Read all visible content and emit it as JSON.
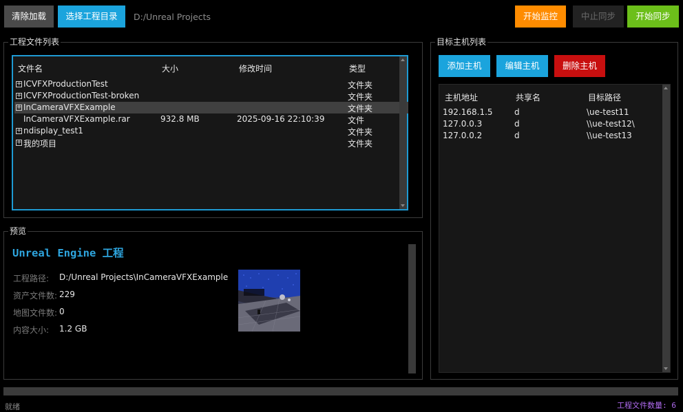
{
  "toolbar": {
    "clear_label": "清除加载",
    "select_label": "选择工程目录",
    "project_path": "D:/Unreal Projects",
    "monitor_label": "开始监控",
    "stop_label": "中止同步",
    "sync_label": "开始同步"
  },
  "files": {
    "group_title": "工程文件列表",
    "columns": {
      "name": "文件名",
      "size": "大小",
      "mtime": "修改时间",
      "type": "类型"
    },
    "rows": [
      {
        "expander": "+",
        "name": "ICVFXProductionTest",
        "size": "",
        "mtime": "",
        "type": "文件夹"
      },
      {
        "expander": "+",
        "name": "ICVFXProductionTest-broken",
        "size": "",
        "mtime": "",
        "type": "文件夹"
      },
      {
        "expander": "+",
        "name": "InCameraVFXExample",
        "size": "",
        "mtime": "",
        "type": "文件夹"
      },
      {
        "expander": "",
        "name": "InCameraVFXExample.rar",
        "size": "932.8 MB",
        "mtime": "2025-09-16 22:10:39",
        "type": "文件"
      },
      {
        "expander": "+",
        "name": "ndisplay_test1",
        "size": "",
        "mtime": "",
        "type": "文件夹"
      },
      {
        "expander": "+",
        "name": "我的项目",
        "size": "",
        "mtime": "",
        "type": "文件夹"
      }
    ]
  },
  "preview": {
    "group_title": "预览",
    "title": "Unreal Engine 工程",
    "path_label": "工程路径:",
    "path_value": "D:/Unreal Projects\\InCameraVFXExample",
    "assets_label": "资产文件数:",
    "assets_value": "229",
    "maps_label": "地图文件数:",
    "maps_value": "0",
    "size_label": "内容大小:",
    "size_value": "1.2 GB"
  },
  "hosts": {
    "group_title": "目标主机列表",
    "add_label": "添加主机",
    "edit_label": "编辑主机",
    "delete_label": "删除主机",
    "columns": {
      "address": "主机地址",
      "share": "共享名",
      "target": "目标路径"
    },
    "rows": [
      {
        "address": "192.168.1.5",
        "share": "d",
        "target": "\\ue-test11"
      },
      {
        "address": "127.0.0.3",
        "share": "d",
        "target": "\\\\ue-test12\\"
      },
      {
        "address": "127.0.0.2",
        "share": "d",
        "target": "\\\\ue-test13"
      }
    ]
  },
  "status": {
    "left": "就绪",
    "right": "工程文件数量: 6"
  },
  "colors": {
    "accent_blue": "#1ba4dd",
    "orange": "#ff8c00",
    "green": "#6cbf1a",
    "red": "#c80f0f",
    "status_purple": "#b06bf0"
  }
}
